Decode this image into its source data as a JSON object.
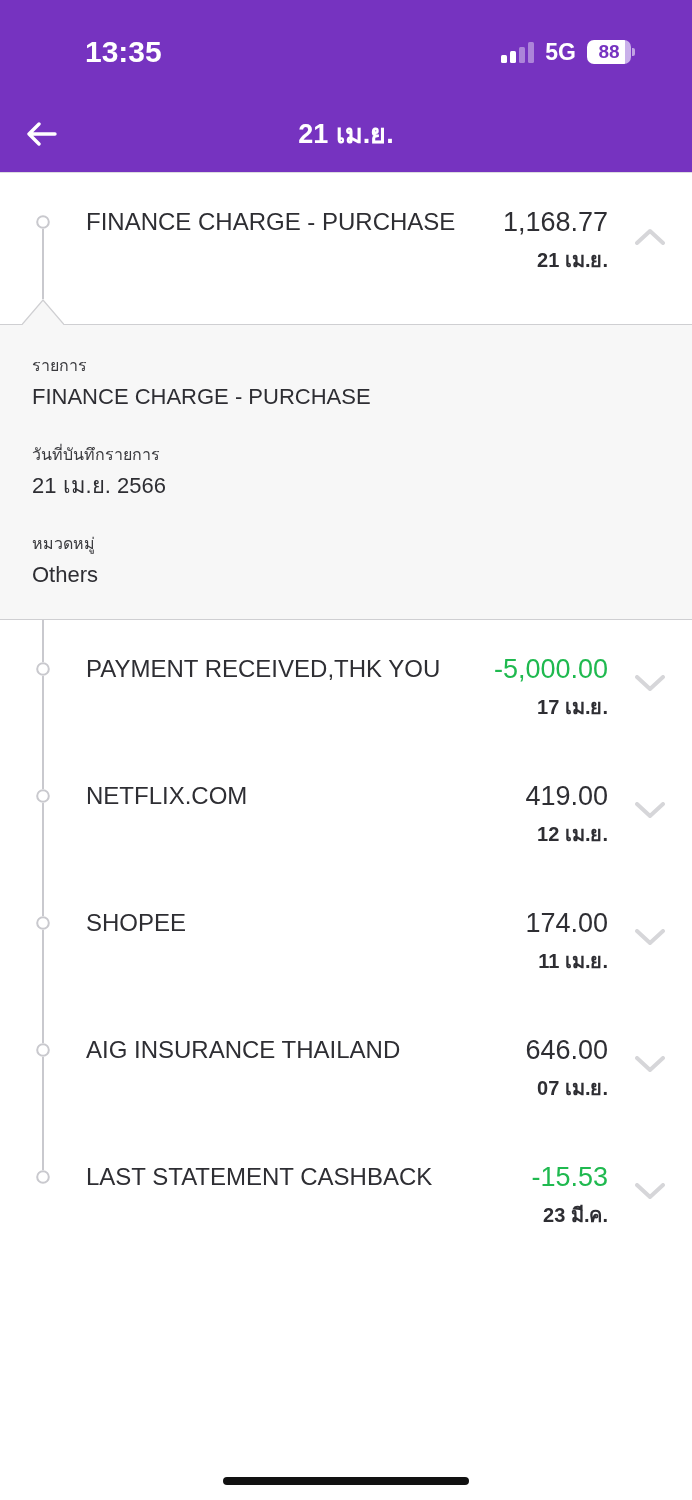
{
  "status_bar": {
    "time": "13:35",
    "network": "5G",
    "battery": "88"
  },
  "header": {
    "title": "21 เม.ย."
  },
  "transactions": [
    {
      "title": "FINANCE CHARGE - PURCHASE",
      "amount": "1,168.77",
      "date": "21 เม.ย.",
      "kind": "charge",
      "expanded": true,
      "details": [
        {
          "label": "รายการ",
          "value": "FINANCE CHARGE - PURCHASE"
        },
        {
          "label": "วันที่บันทึกรายการ",
          "value": "21 เม.ย. 2566"
        },
        {
          "label": "หมวดหมู่",
          "value": "Others"
        }
      ]
    },
    {
      "title": "PAYMENT RECEIVED,THK YOU",
      "amount": "-5,000.00",
      "date": "17 เม.ย.",
      "kind": "payment",
      "expanded": false
    },
    {
      "title": "NETFLIX.COM",
      "amount": "419.00",
      "date": "12 เม.ย.",
      "kind": "charge",
      "expanded": false
    },
    {
      "title": "SHOPEE",
      "amount": "174.00",
      "date": "11 เม.ย.",
      "kind": "charge",
      "expanded": false
    },
    {
      "title": "AIG INSURANCE THAILAND",
      "amount": "646.00",
      "date": "07 เม.ย.",
      "kind": "charge",
      "expanded": false
    },
    {
      "title": "LAST STATEMENT CASHBACK",
      "amount": "-15.53",
      "date": "23 มี.ค.",
      "kind": "payment",
      "expanded": false
    }
  ]
}
